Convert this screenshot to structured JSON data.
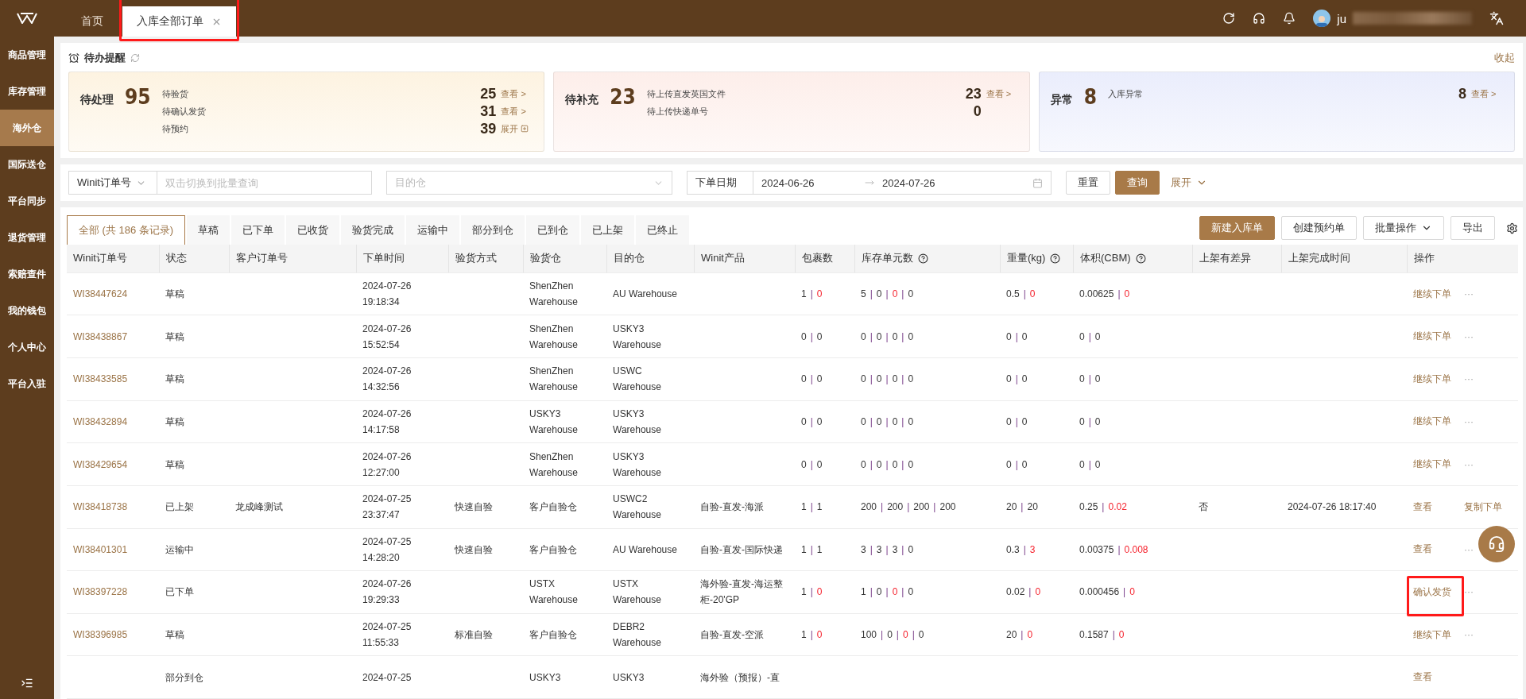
{
  "header": {
    "tabs": [
      {
        "label": "首页",
        "selected": false,
        "closable": false
      },
      {
        "label": "入库全部订单",
        "selected": true,
        "closable": true,
        "highlighted": true
      }
    ],
    "user": {
      "name": "ju"
    }
  },
  "sidebar": {
    "items": [
      {
        "label": "商品管理",
        "selected": false
      },
      {
        "label": "库存管理",
        "selected": false
      },
      {
        "label": "海外仓",
        "selected": true
      },
      {
        "label": "国际送仓",
        "selected": false
      },
      {
        "label": "平台同步",
        "selected": false
      },
      {
        "label": "退货管理",
        "selected": false
      },
      {
        "label": "索赔查件",
        "selected": false
      },
      {
        "label": "我的钱包",
        "selected": false
      },
      {
        "label": "个人中心",
        "selected": false
      },
      {
        "label": "平台入驻",
        "selected": false
      }
    ]
  },
  "reminders": {
    "title": "待办提醒",
    "collapse": "收起",
    "cards": [
      {
        "title": "待处理",
        "total": "95",
        "color": "#fdf3e1",
        "items": [
          {
            "label": "待验货",
            "count": "25",
            "link": "查看 >",
            "kind": "view"
          },
          {
            "label": "待确认发货",
            "count": "31",
            "link": "查看 >",
            "kind": "view"
          },
          {
            "label": "待预约",
            "count": "39",
            "link": "展开",
            "kind": "expand"
          }
        ]
      },
      {
        "title": "待补充",
        "total": "23",
        "color": "#fdeeea",
        "items": [
          {
            "label": "待上传直发英国文件",
            "count": "23",
            "link": "查看 >",
            "kind": "view"
          },
          {
            "label": "待上传快递单号",
            "count": "0",
            "kind": "plain"
          }
        ]
      },
      {
        "title": "异常",
        "total": "8",
        "color": "#eaedfc",
        "items": [
          {
            "label": "入库异常",
            "count": "8",
            "link": "查看 >",
            "kind": "view"
          }
        ]
      }
    ]
  },
  "filters": {
    "field_select": "Winit订单号",
    "search_placeholder": "双击切换到批量查询",
    "warehouse_placeholder": "目的仓",
    "date_label": "下单日期",
    "date_start": "2024-06-26",
    "date_end": "2024-07-26",
    "reset": "重置",
    "query": "查询",
    "expand": "展开"
  },
  "status_tabs": [
    {
      "label": "全部 (共 186 条记录)",
      "selected": true
    },
    {
      "label": "草稿",
      "selected": false
    },
    {
      "label": "已下单",
      "selected": false
    },
    {
      "label": "已收货",
      "selected": false
    },
    {
      "label": "验货完成",
      "selected": false
    },
    {
      "label": "运输中",
      "selected": false
    },
    {
      "label": "部分到仓",
      "selected": false
    },
    {
      "label": "已到仓",
      "selected": false
    },
    {
      "label": "已上架",
      "selected": false
    },
    {
      "label": "已终止",
      "selected": false
    }
  ],
  "toolbar": {
    "buttons": [
      {
        "label": "新建入库单",
        "kind": "primary"
      },
      {
        "label": "创建预约单",
        "kind": "plain"
      },
      {
        "label": "批量操作",
        "kind": "dropdown"
      },
      {
        "label": "导出",
        "kind": "plain"
      }
    ]
  },
  "table": {
    "separator": "|",
    "columns": [
      {
        "label": "Winit订单号"
      },
      {
        "label": "状态"
      },
      {
        "label": "客户订单号"
      },
      {
        "label": "下单时间"
      },
      {
        "label": "验货方式"
      },
      {
        "label": "验货仓"
      },
      {
        "label": "目的仓"
      },
      {
        "label": "Winit产品"
      },
      {
        "label": "包裹数"
      },
      {
        "label": "库存单元数",
        "help": true
      },
      {
        "label": "重量(kg)",
        "help": true
      },
      {
        "label": "体积(CBM)",
        "help": true
      },
      {
        "label": "上架有差异"
      },
      {
        "label": "上架完成时间"
      },
      {
        "label": "操作"
      }
    ],
    "rows": [
      {
        "order": "WI38447624",
        "status": "草稿",
        "customer_order": "",
        "time": [
          "2024-07-26",
          "19:18:34"
        ],
        "inspection": "",
        "inspect_wh": "ShenZhen Warehouse",
        "dest_wh": "AU Warehouse",
        "product": "",
        "packages": [
          {
            "v": "1",
            "alert": false
          },
          {
            "v": "0",
            "alert": true
          }
        ],
        "skus": [
          {
            "v": "5",
            "alert": false
          },
          {
            "v": "0",
            "alert": false
          },
          {
            "v": "0",
            "alert": true
          },
          {
            "v": "0",
            "alert": false
          }
        ],
        "weight": [
          {
            "v": "0.5",
            "alert": false
          },
          {
            "v": "0",
            "alert": true
          }
        ],
        "volume": [
          {
            "v": "0.00625",
            "alert": false
          },
          {
            "v": "0",
            "alert": true
          }
        ],
        "diff": "",
        "done": "",
        "actions": [
          {
            "label": "继续下单",
            "highlighted": false
          }
        ],
        "more": "···"
      },
      {
        "order": "WI38438867",
        "status": "草稿",
        "customer_order": "",
        "time": [
          "2024-07-26",
          "15:52:54"
        ],
        "inspection": "",
        "inspect_wh": "ShenZhen Warehouse",
        "dest_wh": "USKY3 Warehouse",
        "product": "",
        "packages": [
          {
            "v": "0",
            "alert": false
          },
          {
            "v": "0",
            "alert": false
          }
        ],
        "skus": [
          {
            "v": "0",
            "alert": false
          },
          {
            "v": "0",
            "alert": false
          },
          {
            "v": "0",
            "alert": false
          },
          {
            "v": "0",
            "alert": false
          }
        ],
        "weight": [
          {
            "v": "0",
            "alert": false
          },
          {
            "v": "0",
            "alert": false
          }
        ],
        "volume": [
          {
            "v": "0",
            "alert": false
          },
          {
            "v": "0",
            "alert": false
          }
        ],
        "diff": "",
        "done": "",
        "actions": [
          {
            "label": "继续下单",
            "highlighted": false
          }
        ],
        "more": "···"
      },
      {
        "order": "WI38433585",
        "status": "草稿",
        "customer_order": "",
        "time": [
          "2024-07-26",
          "14:32:56"
        ],
        "inspection": "",
        "inspect_wh": "ShenZhen Warehouse",
        "dest_wh": "USWC Warehouse",
        "product": "",
        "packages": [
          {
            "v": "0",
            "alert": false
          },
          {
            "v": "0",
            "alert": false
          }
        ],
        "skus": [
          {
            "v": "0",
            "alert": false
          },
          {
            "v": "0",
            "alert": false
          },
          {
            "v": "0",
            "alert": false
          },
          {
            "v": "0",
            "alert": false
          }
        ],
        "weight": [
          {
            "v": "0",
            "alert": false
          },
          {
            "v": "0",
            "alert": false
          }
        ],
        "volume": [
          {
            "v": "0",
            "alert": false
          },
          {
            "v": "0",
            "alert": false
          }
        ],
        "diff": "",
        "done": "",
        "actions": [
          {
            "label": "继续下单",
            "highlighted": false
          }
        ],
        "more": "···"
      },
      {
        "order": "WI38432894",
        "status": "草稿",
        "customer_order": "",
        "time": [
          "2024-07-26",
          "14:17:58"
        ],
        "inspection": "",
        "inspect_wh": "USKY3 Warehouse",
        "dest_wh": "USKY3 Warehouse",
        "product": "",
        "packages": [
          {
            "v": "0",
            "alert": false
          },
          {
            "v": "0",
            "alert": false
          }
        ],
        "skus": [
          {
            "v": "0",
            "alert": false
          },
          {
            "v": "0",
            "alert": false
          },
          {
            "v": "0",
            "alert": false
          },
          {
            "v": "0",
            "alert": false
          }
        ],
        "weight": [
          {
            "v": "0",
            "alert": false
          },
          {
            "v": "0",
            "alert": false
          }
        ],
        "volume": [
          {
            "v": "0",
            "alert": false
          },
          {
            "v": "0",
            "alert": false
          }
        ],
        "diff": "",
        "done": "",
        "actions": [
          {
            "label": "继续下单",
            "highlighted": false
          }
        ],
        "more": "···"
      },
      {
        "order": "WI38429654",
        "status": "草稿",
        "customer_order": "",
        "time": [
          "2024-07-26",
          "12:27:00"
        ],
        "inspection": "",
        "inspect_wh": "ShenZhen Warehouse",
        "dest_wh": "USKY3 Warehouse",
        "product": "",
        "packages": [
          {
            "v": "0",
            "alert": false
          },
          {
            "v": "0",
            "alert": false
          }
        ],
        "skus": [
          {
            "v": "0",
            "alert": false
          },
          {
            "v": "0",
            "alert": false
          },
          {
            "v": "0",
            "alert": false
          },
          {
            "v": "0",
            "alert": false
          }
        ],
        "weight": [
          {
            "v": "0",
            "alert": false
          },
          {
            "v": "0",
            "alert": false
          }
        ],
        "volume": [
          {
            "v": "0",
            "alert": false
          },
          {
            "v": "0",
            "alert": false
          }
        ],
        "diff": "",
        "done": "",
        "actions": [
          {
            "label": "继续下单",
            "highlighted": false
          }
        ],
        "more": "···"
      },
      {
        "order": "WI38418738",
        "status": "已上架",
        "customer_order": "龙成峰测试",
        "time": [
          "2024-07-25",
          "23:37:47"
        ],
        "inspection": "快速自验",
        "inspect_wh": "客户自验仓",
        "dest_wh": "USWC2 Warehouse",
        "product": "自验-直发-海派",
        "packages": [
          {
            "v": "1",
            "alert": false
          },
          {
            "v": "1",
            "alert": false
          }
        ],
        "skus": [
          {
            "v": "200",
            "alert": false
          },
          {
            "v": "200",
            "alert": false
          },
          {
            "v": "200",
            "alert": false
          },
          {
            "v": "200",
            "alert": false
          }
        ],
        "weight": [
          {
            "v": "20",
            "alert": false
          },
          {
            "v": "20",
            "alert": false
          }
        ],
        "volume": [
          {
            "v": "0.25",
            "alert": false
          },
          {
            "v": "0.02",
            "alert": true
          }
        ],
        "diff": "否",
        "done": "2024-07-26 18:17:40",
        "actions": [
          {
            "label": "查看",
            "highlighted": false
          },
          {
            "label": "复制下单",
            "highlighted": false
          }
        ]
      },
      {
        "order": "WI38401301",
        "status": "运输中",
        "customer_order": "",
        "time": [
          "2024-07-25",
          "14:28:20"
        ],
        "inspection": "快速自验",
        "inspect_wh": "客户自验仓",
        "dest_wh": "AU Warehouse",
        "product": "自验-直发-国际快递",
        "packages": [
          {
            "v": "1",
            "alert": false
          },
          {
            "v": "1",
            "alert": false
          }
        ],
        "skus": [
          {
            "v": "3",
            "alert": false
          },
          {
            "v": "3",
            "alert": false
          },
          {
            "v": "3",
            "alert": false
          },
          {
            "v": "0",
            "alert": false
          }
        ],
        "weight": [
          {
            "v": "0.3",
            "alert": false
          },
          {
            "v": "3",
            "alert": true
          }
        ],
        "volume": [
          {
            "v": "0.00375",
            "alert": false
          },
          {
            "v": "0.008",
            "alert": true
          }
        ],
        "diff": "",
        "done": "",
        "actions": [
          {
            "label": "查看",
            "highlighted": false
          }
        ],
        "more": "···"
      },
      {
        "order": "WI38397228",
        "status": "已下单",
        "customer_order": "",
        "time": [
          "2024-07-26",
          "19:29:33"
        ],
        "inspection": "",
        "inspect_wh": "USTX Warehouse",
        "dest_wh": "USTX Warehouse",
        "product": "海外验-直发-海运整柜-20'GP",
        "packages": [
          {
            "v": "1",
            "alert": false
          },
          {
            "v": "0",
            "alert": true
          }
        ],
        "skus": [
          {
            "v": "1",
            "alert": false
          },
          {
            "v": "0",
            "alert": false
          },
          {
            "v": "0",
            "alert": true
          },
          {
            "v": "0",
            "alert": false
          }
        ],
        "weight": [
          {
            "v": "0.02",
            "alert": false
          },
          {
            "v": "0",
            "alert": true
          }
        ],
        "volume": [
          {
            "v": "0.000456",
            "alert": false
          },
          {
            "v": "0",
            "alert": true
          }
        ],
        "diff": "",
        "done": "",
        "actions": [
          {
            "label": "确认发货",
            "highlighted": true
          }
        ],
        "more": "···"
      },
      {
        "order": "WI38396985",
        "status": "草稿",
        "customer_order": "",
        "time": [
          "2024-07-25",
          "11:55:33"
        ],
        "inspection": "标准自验",
        "inspect_wh": "客户自验仓",
        "dest_wh": "DEBR2 Warehouse",
        "product": "自验-直发-空派",
        "packages": [
          {
            "v": "1",
            "alert": false
          },
          {
            "v": "0",
            "alert": true
          }
        ],
        "skus": [
          {
            "v": "100",
            "alert": false
          },
          {
            "v": "0",
            "alert": false
          },
          {
            "v": "0",
            "alert": true
          },
          {
            "v": "0",
            "alert": false
          }
        ],
        "weight": [
          {
            "v": "20",
            "alert": false
          },
          {
            "v": "0",
            "alert": true
          }
        ],
        "volume": [
          {
            "v": "0.1587",
            "alert": false
          },
          {
            "v": "0",
            "alert": true
          }
        ],
        "diff": "",
        "done": "",
        "actions": [
          {
            "label": "继续下单",
            "highlighted": false
          }
        ],
        "more": "···"
      },
      {
        "order": "",
        "status": "部分到仓",
        "customer_order": "",
        "time": [
          "2024-07-25"
        ],
        "inspection": "",
        "inspect_wh": "USKY3",
        "dest_wh": "USKY3",
        "product": "海外验（预报）-直",
        "packages": [],
        "skus": [],
        "weight": [],
        "volume": [],
        "diff": "",
        "done": "",
        "actions": [
          {
            "label": "查看",
            "highlighted": false
          }
        ]
      }
    ]
  }
}
